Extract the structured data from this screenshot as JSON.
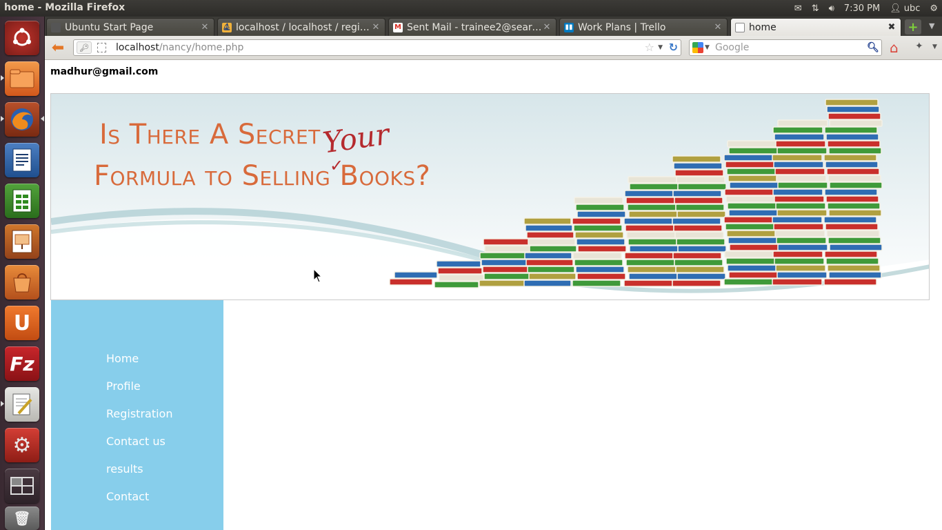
{
  "top_panel": {
    "window_title": "home - Mozilla Firefox",
    "time": "7:30 PM",
    "user": "ubc"
  },
  "launcher": {
    "items": [
      {
        "name": "Dash Home",
        "icon": "ubuntu-logo-icon"
      },
      {
        "name": "Files",
        "icon": "folder-icon"
      },
      {
        "name": "Firefox",
        "icon": "firefox-icon"
      },
      {
        "name": "LibreOffice Writer",
        "icon": "writer-icon"
      },
      {
        "name": "LibreOffice Calc",
        "icon": "calc-icon"
      },
      {
        "name": "LibreOffice Impress",
        "icon": "impress-icon"
      },
      {
        "name": "Ubuntu Software Center",
        "icon": "software-center-icon"
      },
      {
        "name": "Ubuntu One",
        "icon": "ubuntu-one-icon"
      },
      {
        "name": "FileZilla",
        "icon": "filezilla-icon",
        "text": "Fz"
      },
      {
        "name": "Text Editor",
        "icon": "text-editor-icon"
      },
      {
        "name": "System Settings",
        "icon": "settings-icon"
      },
      {
        "name": "Workspace Switcher",
        "icon": "workspaces-icon"
      },
      {
        "name": "Trash",
        "icon": "trash-icon"
      }
    ]
  },
  "browser": {
    "tabs": [
      {
        "title": "Ubuntu Start Page",
        "active": false
      },
      {
        "title": "localhost / localhost / regis...",
        "active": false
      },
      {
        "title": "Sent Mail - trainee2@searc...",
        "active": false
      },
      {
        "title": "Work Plans | Trello",
        "active": false
      },
      {
        "title": "home",
        "active": true
      }
    ],
    "url_host": "localhost",
    "url_path": "/nancy/home.php",
    "search_placeholder": "Google"
  },
  "page": {
    "user_email": "madhur@gmail.com",
    "banner": {
      "line1": "Is There A Secret",
      "line2": "Formula to Selling Books?",
      "insert_word": "Your"
    },
    "menu": [
      "Home",
      "Profile",
      "Registration",
      "Contact us",
      "results",
      "Contact"
    ]
  },
  "colors": {
    "sidebar_bg": "#87ceeb",
    "banner_text": "#d86a3b",
    "scribble": "#b52a2e"
  }
}
